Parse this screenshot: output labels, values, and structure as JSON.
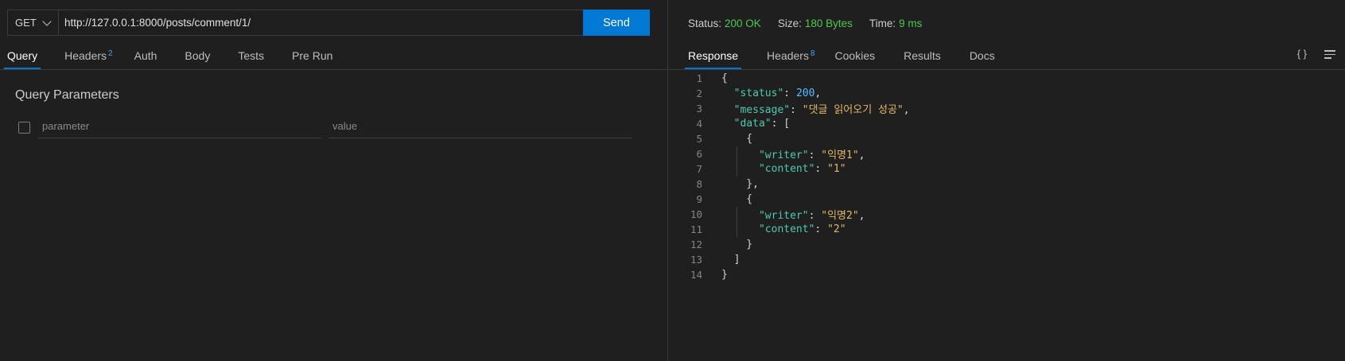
{
  "request": {
    "method": "GET",
    "url": "http://127.0.0.1:8000/posts/comment/1/",
    "send_label": "Send"
  },
  "request_tabs": [
    {
      "label": "Query",
      "badge": ""
    },
    {
      "label": "Headers",
      "badge": "2"
    },
    {
      "label": "Auth",
      "badge": ""
    },
    {
      "label": "Body",
      "badge": ""
    },
    {
      "label": "Tests",
      "badge": ""
    },
    {
      "label": "Pre Run",
      "badge": ""
    }
  ],
  "query": {
    "title": "Query Parameters",
    "param_placeholder": "parameter",
    "value_placeholder": "value"
  },
  "response_status": {
    "status_label": "Status:",
    "status_value": "200 OK",
    "size_label": "Size:",
    "size_value": "180 Bytes",
    "time_label": "Time:",
    "time_value": "9 ms"
  },
  "response_tabs": [
    {
      "label": "Response",
      "badge": ""
    },
    {
      "label": "Headers",
      "badge": "8"
    },
    {
      "label": "Cookies",
      "badge": ""
    },
    {
      "label": "Results",
      "badge": ""
    },
    {
      "label": "Docs",
      "badge": ""
    }
  ],
  "tools": {
    "format_label": "{ }"
  },
  "response_lines": [
    "{",
    "  \"status\": 200,",
    "  \"message\": \"댓글 읽어오기 성공\",",
    "  \"data\": [",
    "    {",
    "      \"writer\": \"익명1\",",
    "      \"content\": \"1\"",
    "    },",
    "    {",
    "      \"writer\": \"익명2\",",
    "      \"content\": \"2\"",
    "    }",
    "  ]",
    "}"
  ],
  "colors": {
    "accent": "#0078d4",
    "success": "#4ec94e",
    "badge": "#3ea6ff"
  }
}
